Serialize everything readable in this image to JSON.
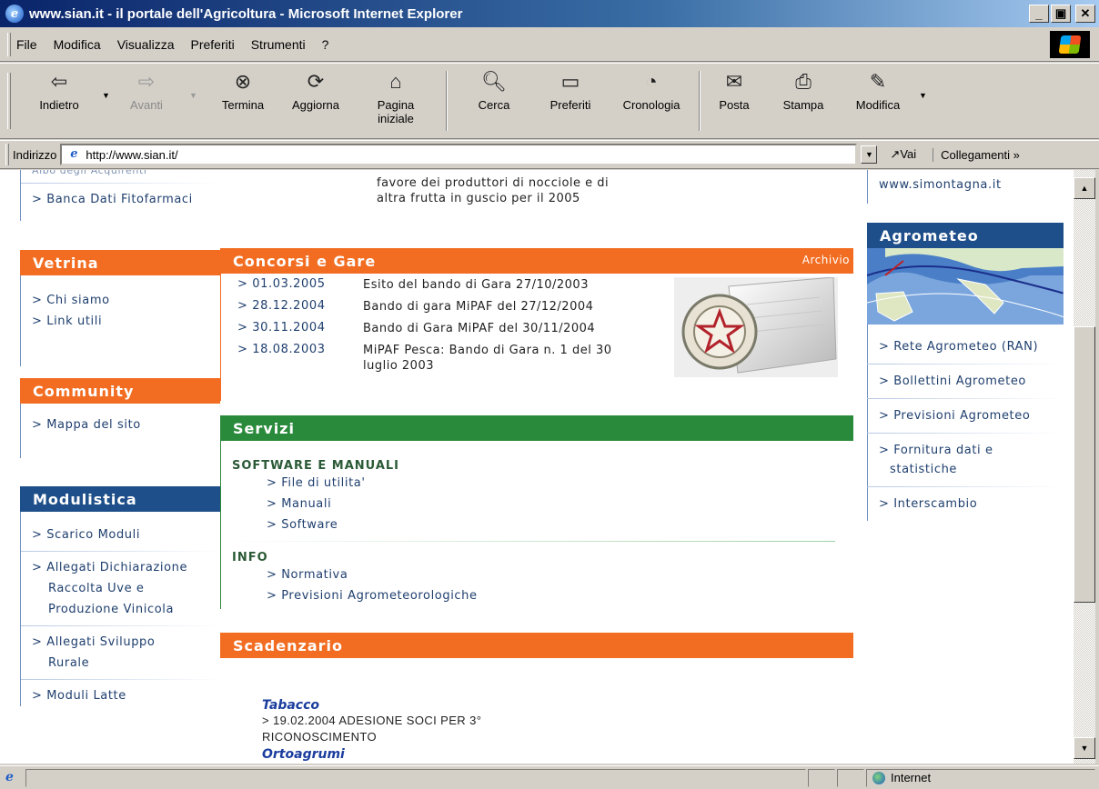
{
  "window": {
    "title": "www.sian.it - il portale dell'Agricoltura - Microsoft Internet Explorer",
    "minimize": "_",
    "maximize": "▣",
    "close": "✕"
  },
  "menu": [
    "File",
    "Modifica",
    "Visualizza",
    "Preferiti",
    "Strumenti",
    "?"
  ],
  "toolbar": {
    "back": "Indietro",
    "forward": "Avanti",
    "stop": "Termina",
    "refresh": "Aggiorna",
    "home_line1": "Pagina",
    "home_line2": "iniziale",
    "search": "Cerca",
    "favorites": "Preferiti",
    "history": "Cronologia",
    "mail": "Posta",
    "print": "Stampa",
    "edit": "Modifica"
  },
  "address": {
    "label": "Indirizzo",
    "url": "http://www.sian.it/",
    "go": "Vai",
    "links": "Collegamenti »"
  },
  "left": {
    "top_partial": "Albo degli Acquirenti",
    "banca_dati": "> Banca Dati Fitofarmaci",
    "vetrina": {
      "title": "Vetrina",
      "links": [
        "> Chi siamo",
        "> Link utili"
      ]
    },
    "community": {
      "title": "Community",
      "links": [
        "> Mappa del sito"
      ]
    },
    "modulistica": {
      "title": "Modulistica",
      "links": [
        "> Scarico Moduli",
        "> Allegati Dichiarazione",
        "Raccolta Uve e",
        "Produzione Vinicola",
        "> Allegati Sviluppo",
        "Rurale",
        "> Moduli Latte"
      ]
    }
  },
  "center": {
    "top_text_line1": "favore dei produttori di nocciole e di",
    "top_text_line2": "altra frutta in guscio per il 2005",
    "concorsi": {
      "title": "Concorsi e Gare",
      "archive": "Archivio",
      "items": [
        {
          "date": "> 01.03.2005",
          "title": "Esito del bando di Gara 27/10/2003"
        },
        {
          "date": "> 28.12.2004",
          "title": "Bando di gara MiPAF del 27/12/2004"
        },
        {
          "date": "> 30.11.2004",
          "title": "Bando di Gara MiPAF del 30/11/2004"
        },
        {
          "date": "> 18.08.2003",
          "title": "MiPAF Pesca: Bando di Gara n. 1 del 30 luglio 2003"
        }
      ]
    },
    "servizi": {
      "title": "Servizi",
      "software_heading": "SOFTWARE E MANUALI",
      "software_links": [
        "> File di utilita'",
        "> Manuali",
        "> Software"
      ],
      "info_heading": "INFO",
      "info_links": [
        "> Normativa",
        "> Previsioni Agrometeorologiche"
      ]
    },
    "scadenzario": {
      "title": "Scadenzario",
      "item_title": "Tabacco",
      "item_text_line1": "> 19.02.2004 ADESIONE SOCI PER 3°",
      "item_text_line2": "RICONOSCIMENTO",
      "next_partial": "Ortoagrumi"
    }
  },
  "right": {
    "top_link": "www.simontagna.it",
    "agrometeo": {
      "title": "Agrometeo",
      "links": [
        "> Rete Agrometeo (RAN)",
        "> Bollettini Agrometeo",
        "> Previsioni Agrometeo",
        "> Fornitura dati e",
        "statistiche",
        "> Interscambio"
      ]
    }
  },
  "status": {
    "zone": "Internet"
  }
}
